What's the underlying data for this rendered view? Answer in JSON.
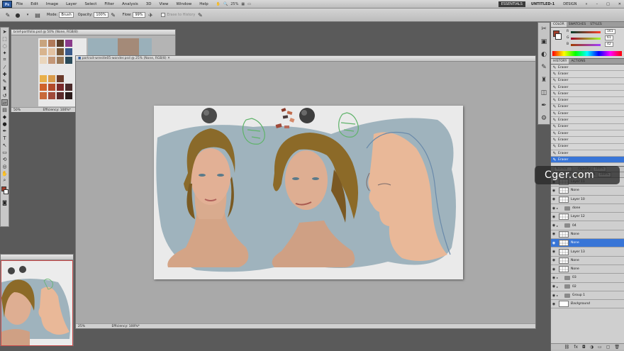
{
  "menubar": {
    "logo": "Ps",
    "items": [
      "File",
      "Edit",
      "Image",
      "Layer",
      "Select",
      "Filter",
      "Analysis",
      "3D",
      "View",
      "Window",
      "Help"
    ],
    "zoom": "25%",
    "workspaces": [
      "ESSENTIALS",
      "UNTITLED-1",
      "DESIGN"
    ],
    "active_workspace": "UNTITLED-1",
    "more": "»"
  },
  "options": {
    "mode_label": "Mode:",
    "mode_value": "Brush",
    "opacity_label": "Opacity:",
    "opacity_value": "100%",
    "flow_label": "Flow:",
    "flow_value": "99%",
    "erase_history_label": "Erase to History"
  },
  "doc_small": {
    "tab": "brief-portfolio.psd @ 50% (None, RGB/8)",
    "status": "Efficiency: 100%*",
    "zoom": "50%"
  },
  "doc_main": {
    "tab": "portrait-wrestle05-wonder.psd @ 25% (None, RGB/8)",
    "zoom": "25%",
    "status": "Efficiency: 100%*"
  },
  "doc_bottom": {
    "tab": ""
  },
  "color_panel": {
    "tabs": [
      "COLOR",
      "SWATCHES",
      "STYLES"
    ],
    "r_label": "R",
    "g_label": "G",
    "b_label": "B",
    "r_value": "161",
    "g_value": "61",
    "b_value": "42",
    "fg_color": "#a13d2a"
  },
  "history_panel": {
    "tabs": [
      "HISTORY",
      "ACTIONS"
    ],
    "steps": [
      "Eraser",
      "Eraser",
      "Eraser",
      "Eraser",
      "Eraser",
      "Eraser",
      "Eraser",
      "Eraser",
      "Eraser",
      "Eraser",
      "Eraser",
      "Eraser",
      "Eraser",
      "Eraser"
    ],
    "active_step": "Eraser"
  },
  "layers_panel": {
    "blend": "Normal",
    "opacity_label": "Opacity:",
    "opacity_value": "100%",
    "lock_label": "Lock:",
    "fill_label": "Fill:",
    "fill_value": "100%",
    "layers": [
      {
        "name": "Layer 11",
        "kind": "layer"
      },
      {
        "name": "None",
        "kind": "layer"
      },
      {
        "name": "Layer 10",
        "kind": "layer"
      },
      {
        "name": "done",
        "kind": "group"
      },
      {
        "name": "Layer 12",
        "kind": "layer"
      },
      {
        "name": "04",
        "kind": "group"
      },
      {
        "name": "None",
        "kind": "layer"
      },
      {
        "name": "None",
        "kind": "layer",
        "active": true
      },
      {
        "name": "Layer 13",
        "kind": "layer"
      },
      {
        "name": "None",
        "kind": "layer"
      },
      {
        "name": "None",
        "kind": "layer"
      },
      {
        "name": "03",
        "kind": "group"
      },
      {
        "name": "02",
        "kind": "group"
      },
      {
        "name": "Group 1",
        "kind": "group"
      },
      {
        "name": "Background",
        "kind": "layer"
      }
    ]
  },
  "watermark": "Cger.com",
  "colors": {
    "accent": "#3875d7",
    "canvas_bg": "#eaeaea",
    "wash": "#9fb3bd",
    "skin": "#e2b095",
    "hair": "#8a6a2a"
  }
}
